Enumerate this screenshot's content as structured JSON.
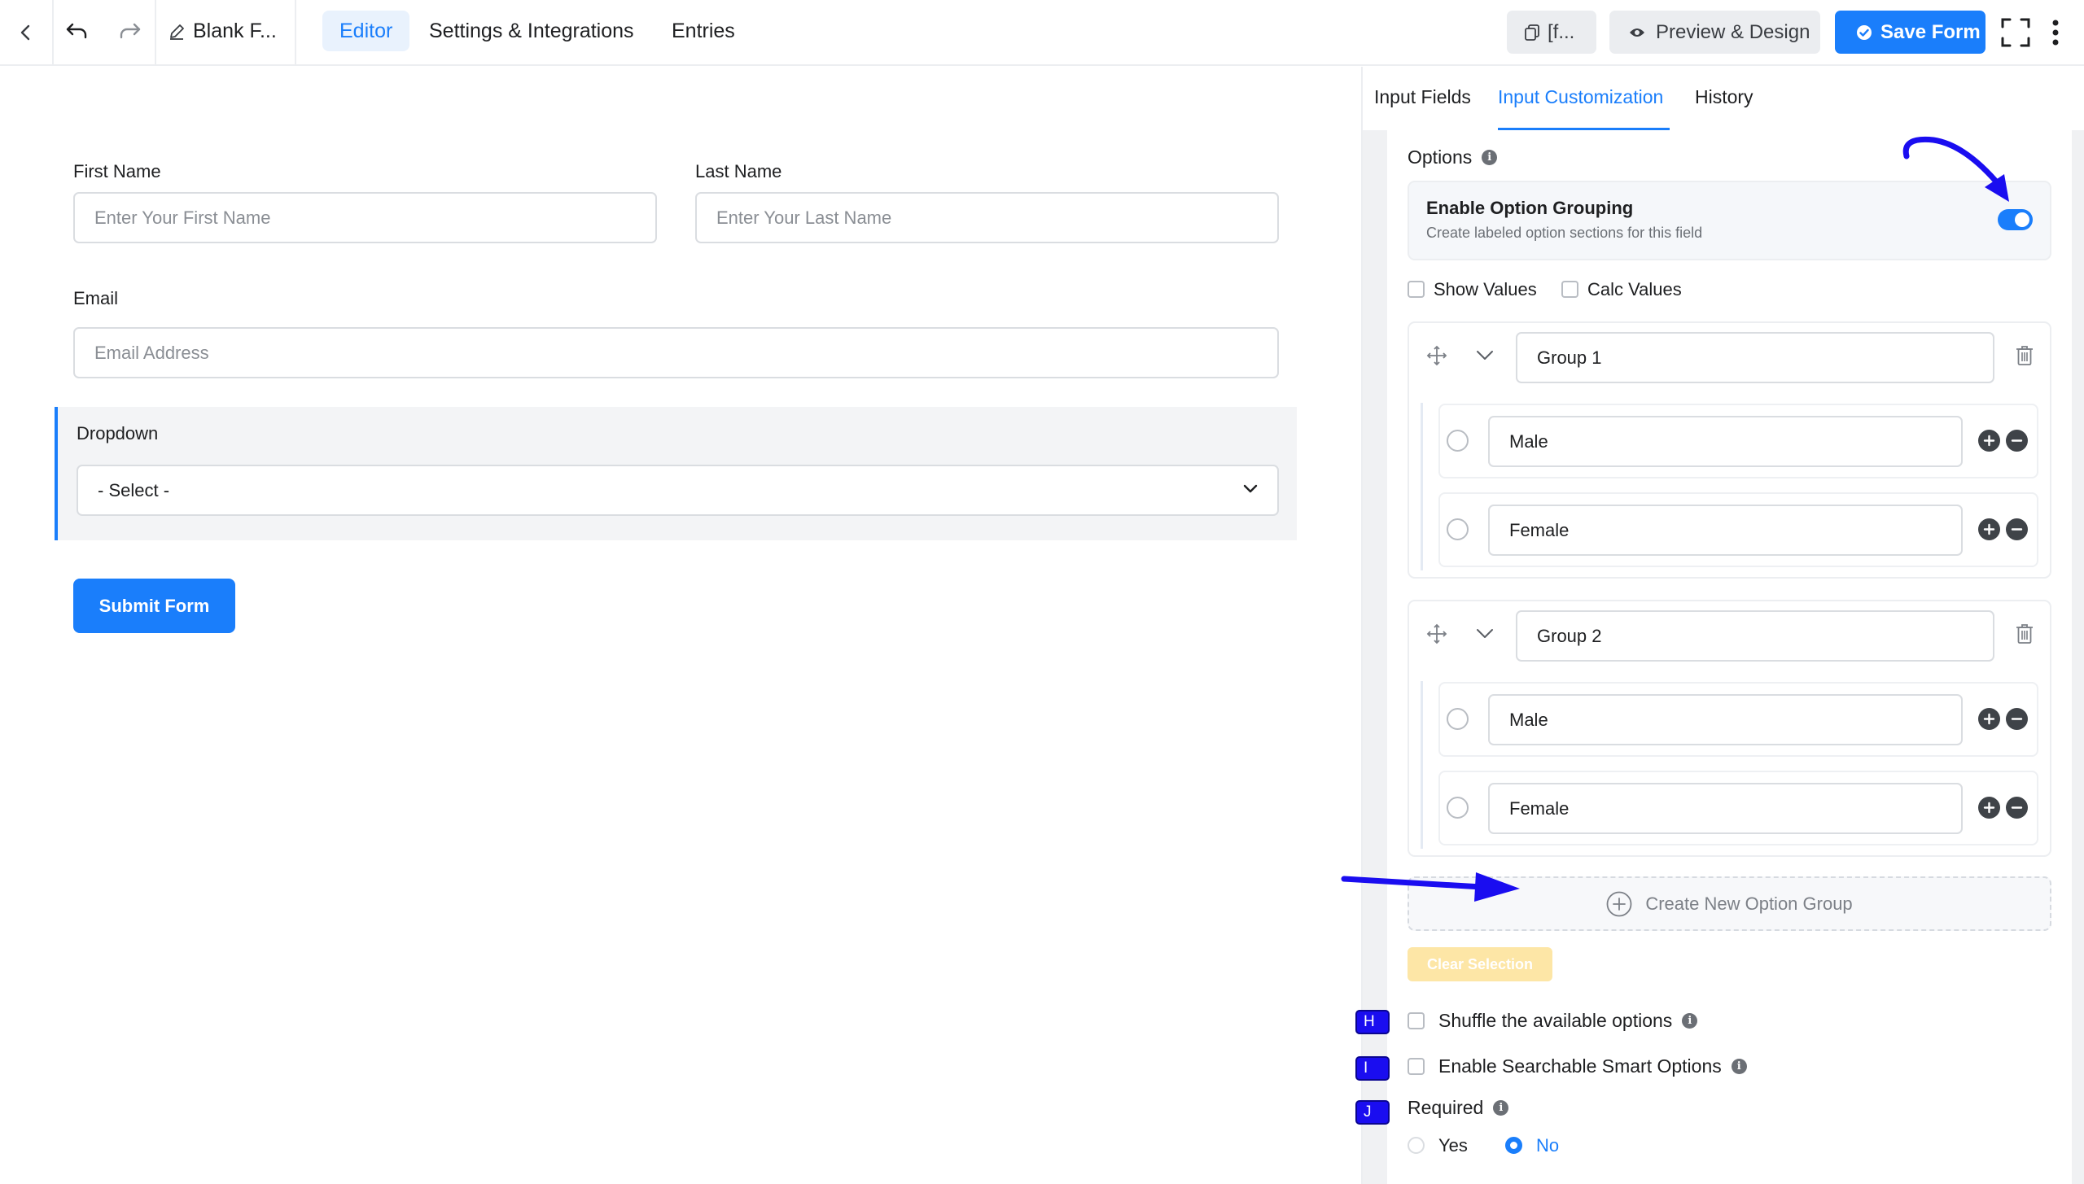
{
  "topbar": {
    "form_title": "Blank F...",
    "tabs": [
      "Editor",
      "Settings & Integrations",
      "Entries"
    ],
    "shortcode_label": "[f...",
    "preview_label": "Preview & Design",
    "save_label": "Save Form"
  },
  "form": {
    "first_name": {
      "label": "First Name",
      "placeholder": "Enter Your First Name"
    },
    "last_name": {
      "label": "Last Name",
      "placeholder": "Enter Your Last Name"
    },
    "email": {
      "label": "Email",
      "placeholder": "Email Address"
    },
    "dropdown": {
      "label": "Dropdown",
      "selected": "- Select -"
    },
    "submit_label": "Submit Form"
  },
  "panel": {
    "tabs": [
      "Input Fields",
      "Input Customization",
      "History"
    ],
    "active_tab": "Input Customization",
    "options_label": "Options",
    "option_grouping": {
      "title": "Enable Option Grouping",
      "subtitle": "Create labeled option sections for this field",
      "enabled": true
    },
    "show_values": "Show Values",
    "calc_values": "Calc Values",
    "groups": [
      {
        "name": "Group 1",
        "options": [
          "Male",
          "Female"
        ]
      },
      {
        "name": "Group 2",
        "options": [
          "Male",
          "Female"
        ]
      }
    ],
    "create_group_label": "Create New Option Group",
    "clear_selection_label": "Clear Selection",
    "shuffle_label": "Shuffle the available options",
    "searchable_label": "Enable Searchable Smart Options",
    "required_label": "Required",
    "required_options": [
      "Yes",
      "No"
    ],
    "required_selected": "No",
    "badges": [
      "H",
      "I",
      "J"
    ]
  },
  "colors": {
    "accent": "#1a7efb",
    "annotation": "#1a0df0"
  }
}
